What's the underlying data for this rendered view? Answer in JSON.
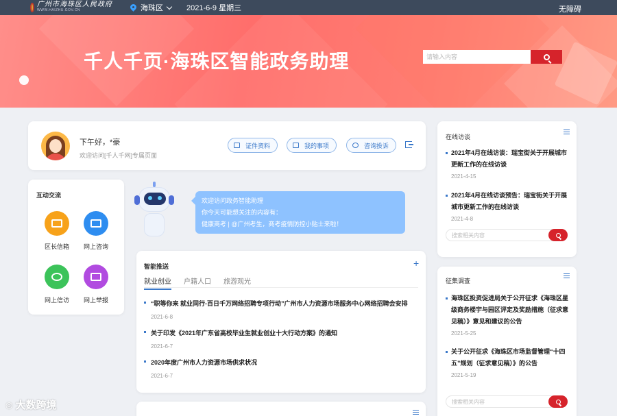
{
  "topbar": {
    "logo_cn": "广州市海珠区人民政府",
    "logo_en": "WWW.HAIZHU.GOV.CN",
    "district": "海珠区",
    "date": "2021-6-9 星期三",
    "accessibility": "无障碍"
  },
  "banner": {
    "title": "千人千页·海珠区智能政务助理",
    "search_placeholder": "请输入内容"
  },
  "greeting": {
    "title": "下午好，*豪",
    "subtitle": "欢迎访问[千人千网]专属页面",
    "buttons": [
      "证件资料",
      "我的事项",
      "咨询投诉"
    ]
  },
  "interaction": {
    "title": "互动交流",
    "items": [
      {
        "label": "区长信箱",
        "icon": "mail-icon",
        "color": "#f7a21a"
      },
      {
        "label": "网上咨询",
        "icon": "chat-icon",
        "color": "#2e8df0"
      },
      {
        "label": "网上信访",
        "icon": "letter-icon",
        "color": "#3cc35a"
      },
      {
        "label": "网上举报",
        "icon": "report-icon",
        "color": "#b14be0"
      }
    ]
  },
  "assistant": {
    "line1": "欢迎访问政务智能助理",
    "line2": "你今天可能想关注的内容有：",
    "line3": "健康商考 | @广州考生，商考疫情防控小贴士来啦！"
  },
  "smart_push": {
    "title": "智能推送",
    "tabs": [
      "就业创业",
      "户籍人口",
      "旅游观光"
    ],
    "items": [
      {
        "title": "“职等你来 就业同行-百日千万网络招聘专项行动”广州市人力资源市场服务中心网络招聘会安排",
        "date": "2021-6-8"
      },
      {
        "title": "关于印发《2021年广东省高校毕业生就业创业十大行动方案》的通知",
        "date": "2021-6-7"
      },
      {
        "title": "2020年度广州市人力资源市场供求状况",
        "date": "2021-6-7"
      }
    ]
  },
  "online_interview": {
    "title": "在线访谈",
    "items": [
      {
        "title": "2021年4月在线访谈：瑞宝街关于开展城市更新工作的在线访谈",
        "date": "2021-4-15"
      },
      {
        "title": "2021年4月在线访谈预告：瑞宝街关于开展城市更新工作的在线访谈",
        "date": "2021-4-8"
      }
    ],
    "search_placeholder": "搜索相关内容"
  },
  "collection": {
    "title": "征集调查",
    "items": [
      {
        "title": "海珠区投资促进局关于公开征求《海珠区星级商务楼宇与园区评定及奖励措施（征求意见稿）》意见和建议的公告",
        "date": "2021-5-25"
      },
      {
        "title": "关于公开征求《海珠区市场监督管理“十四五”规划（征求意见稿）》的公告",
        "date": "2021-5-19"
      }
    ],
    "search_placeholder": "搜索相关内容"
  },
  "watermark": "大数跨境",
  "colors": {
    "accent": "#3a78c9",
    "brand_red": "#d6232b",
    "bubble": "#8ec2ff"
  }
}
